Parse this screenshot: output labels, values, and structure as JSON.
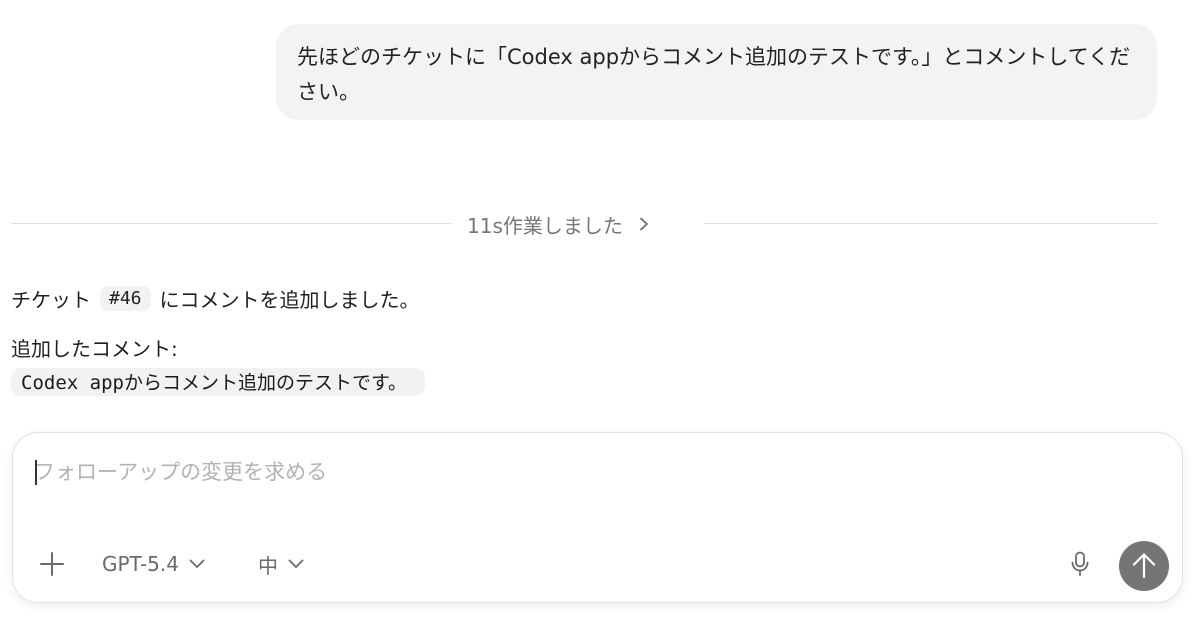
{
  "conversation": {
    "user_message": "先ほどのチケットに「Codex appからコメント追加のテストです。」とコメントしてください。",
    "work_summary": {
      "label": "11s作業しました",
      "expand_icon": "chevron-right-icon"
    },
    "assistant": {
      "sentence_prefix": "チケット",
      "ticket_ref": "#46",
      "sentence_suffix": "にコメントを追加しました。",
      "comment_label": "追加したコメント:",
      "comment_text": "Codex appからコメント追加のテストです。"
    }
  },
  "composer": {
    "placeholder": "フォローアップの変更を求める",
    "value": "",
    "attach_icon": "plus-icon",
    "model_label": "GPT-5.4",
    "effort_label": "中",
    "mic_icon": "microphone-icon",
    "send_icon": "arrow-up-icon"
  },
  "colors": {
    "user_bubble_bg": "#f3f3f3",
    "send_button_bg": "#757575",
    "muted_text": "#6a6a6a",
    "placeholder_text": "#b3b3b3"
  }
}
